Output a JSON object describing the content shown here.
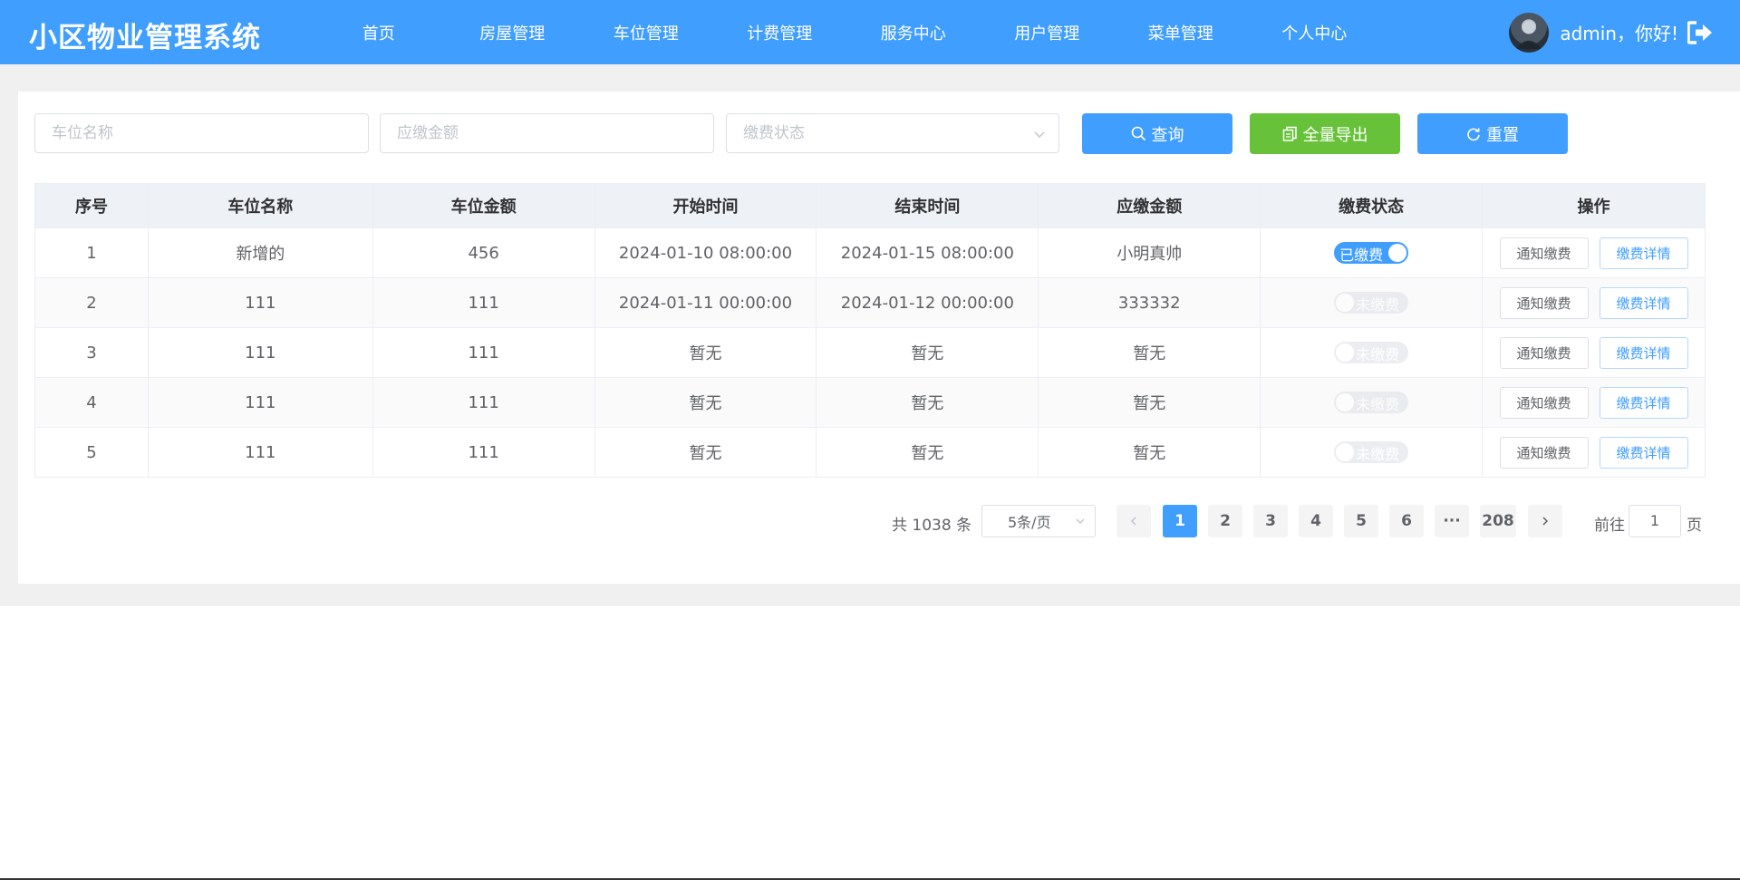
{
  "app": {
    "title": "小区物业管理系统"
  },
  "nav": {
    "items": [
      {
        "label": "首页"
      },
      {
        "label": "房屋管理"
      },
      {
        "label": "车位管理"
      },
      {
        "label": "计费管理"
      },
      {
        "label": "服务中心"
      },
      {
        "label": "用户管理"
      },
      {
        "label": "菜单管理"
      },
      {
        "label": "个人中心"
      }
    ]
  },
  "user": {
    "greeting": "admin，你好!",
    "avatar_icon": "user-avatar",
    "logout_icon": "logout-icon"
  },
  "search": {
    "name_placeholder": "车位名称",
    "amount_placeholder": "应缴金额",
    "status_placeholder": "缴费状态",
    "query_label": "查询",
    "export_label": "全量导出",
    "reset_label": "重置"
  },
  "table": {
    "columns": [
      "序号",
      "车位名称",
      "车位金额",
      "开始时间",
      "结束时间",
      "应缴金额",
      "缴费状态",
      "操作"
    ],
    "rows": [
      {
        "index": "1",
        "name": "新增的",
        "amount": "456",
        "start": "2024-01-10 08:00:00",
        "end": "2024-01-15 08:00:00",
        "due": "小明真帅",
        "status": "已缴费",
        "paid": true
      },
      {
        "index": "2",
        "name": "111",
        "amount": "111",
        "start": "2024-01-11 00:00:00",
        "end": "2024-01-12 00:00:00",
        "due": "333332",
        "status": "未缴费",
        "paid": false
      },
      {
        "index": "3",
        "name": "111",
        "amount": "111",
        "start": "暂无",
        "end": "暂无",
        "due": "暂无",
        "status": "未缴费",
        "paid": false
      },
      {
        "index": "4",
        "name": "111",
        "amount": "111",
        "start": "暂无",
        "end": "暂无",
        "due": "暂无",
        "status": "未缴费",
        "paid": false
      },
      {
        "index": "5",
        "name": "111",
        "amount": "111",
        "start": "暂无",
        "end": "暂无",
        "due": "暂无",
        "status": "未缴费",
        "paid": false
      }
    ],
    "notify_label": "通知缴费",
    "detail_label": "缴费详情"
  },
  "pagination": {
    "total": "共 1038 条",
    "page_size": "5条/页",
    "pages": [
      "1",
      "2",
      "3",
      "4",
      "5",
      "6",
      "···",
      "208"
    ],
    "current": "1",
    "goto_label": "前往",
    "goto_value": "1",
    "page_suffix": "页"
  },
  "colors": {
    "primary": "#409eff",
    "success": "#67c23a",
    "header_bg": "#409eff"
  }
}
